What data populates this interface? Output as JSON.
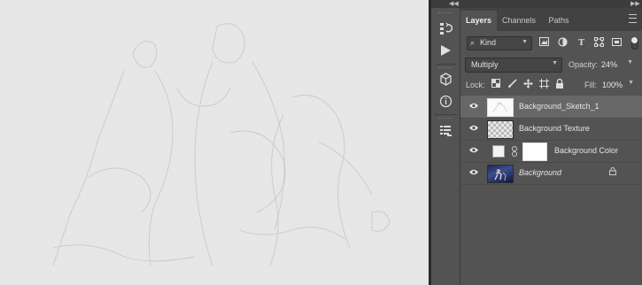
{
  "panel": {
    "tabs": [
      {
        "label": "Layers"
      },
      {
        "label": "Channels"
      },
      {
        "label": "Paths"
      }
    ],
    "filter": {
      "kind_label": "Kind"
    },
    "blend_mode": "Multiply",
    "opacity_label": "Opacity:",
    "opacity_value": "24%",
    "lock_label": "Lock:",
    "fill_label": "Fill:",
    "fill_value": "100%",
    "layers": [
      {
        "name": "Background_Sketch_1",
        "selected": true
      },
      {
        "name": "Background Texture"
      },
      {
        "name": "Background Color"
      },
      {
        "name": "Background",
        "locked": true
      }
    ]
  }
}
